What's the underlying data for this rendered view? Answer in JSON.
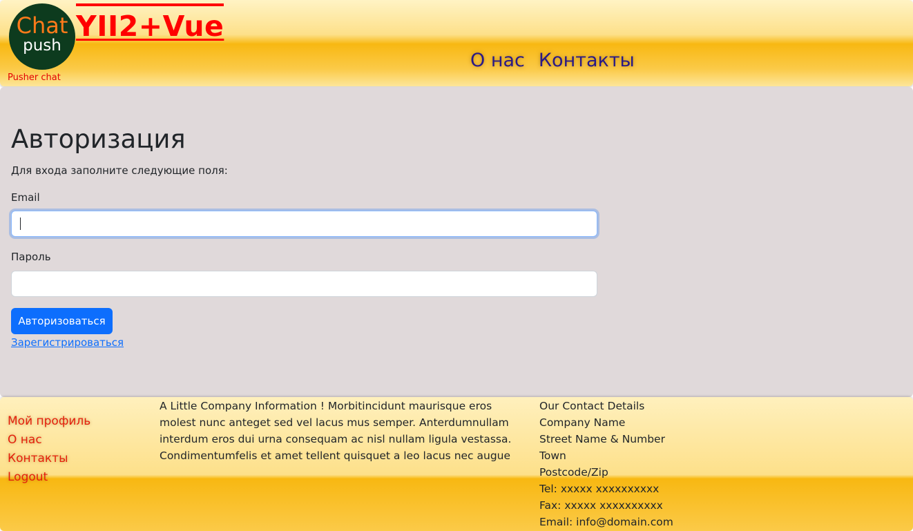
{
  "header": {
    "logo": {
      "line1": "Chat",
      "line2": "push"
    },
    "brand_title": "YII2+Vue",
    "brand_subtitle": "Pusher chat",
    "nav": [
      {
        "label": "О нас"
      },
      {
        "label": "Контакты"
      }
    ]
  },
  "login": {
    "title": "Авторизация",
    "intro": "Для входа заполните следующие поля:",
    "email_label": "Email",
    "email_value": "",
    "password_label": "Пароль",
    "password_value": "",
    "submit_label": "Авторизоваться",
    "register_link": "Зарегистрироваться"
  },
  "footer": {
    "nav": [
      {
        "label": "Мой профиль"
      },
      {
        "label": "О нас"
      },
      {
        "label": "Контакты"
      },
      {
        "label": "Logout"
      }
    ],
    "about": "A Little Company Information ! Morbitincidunt maurisque eros molest nunc anteget sed vel lacus mus semper. Anterdumnullam interdum eros dui urna consequam ac nisl nullam ligula vestassa. Condimentumfelis et amet tellent quisquet a leo lacus nec augue",
    "contact": {
      "heading": "Our Contact Details",
      "company": "Company Name",
      "street": "Street Name & Number",
      "town": "Town",
      "postcode": "Postcode/Zip",
      "tel": "Tel: xxxxx xxxxxxxxxx",
      "fax": "Fax: xxxxx xxxxxxxxxx",
      "email": "Email: info@domain.com"
    }
  },
  "colors": {
    "brand_red": "#ff0000",
    "nav_text": "#2a1a86",
    "footer_link": "#e3200d",
    "primary_button": "#0d6efd",
    "main_background": "#e0d9da",
    "logo_background": "#0d3b1e",
    "logo_chat": "#ff7a1a"
  }
}
